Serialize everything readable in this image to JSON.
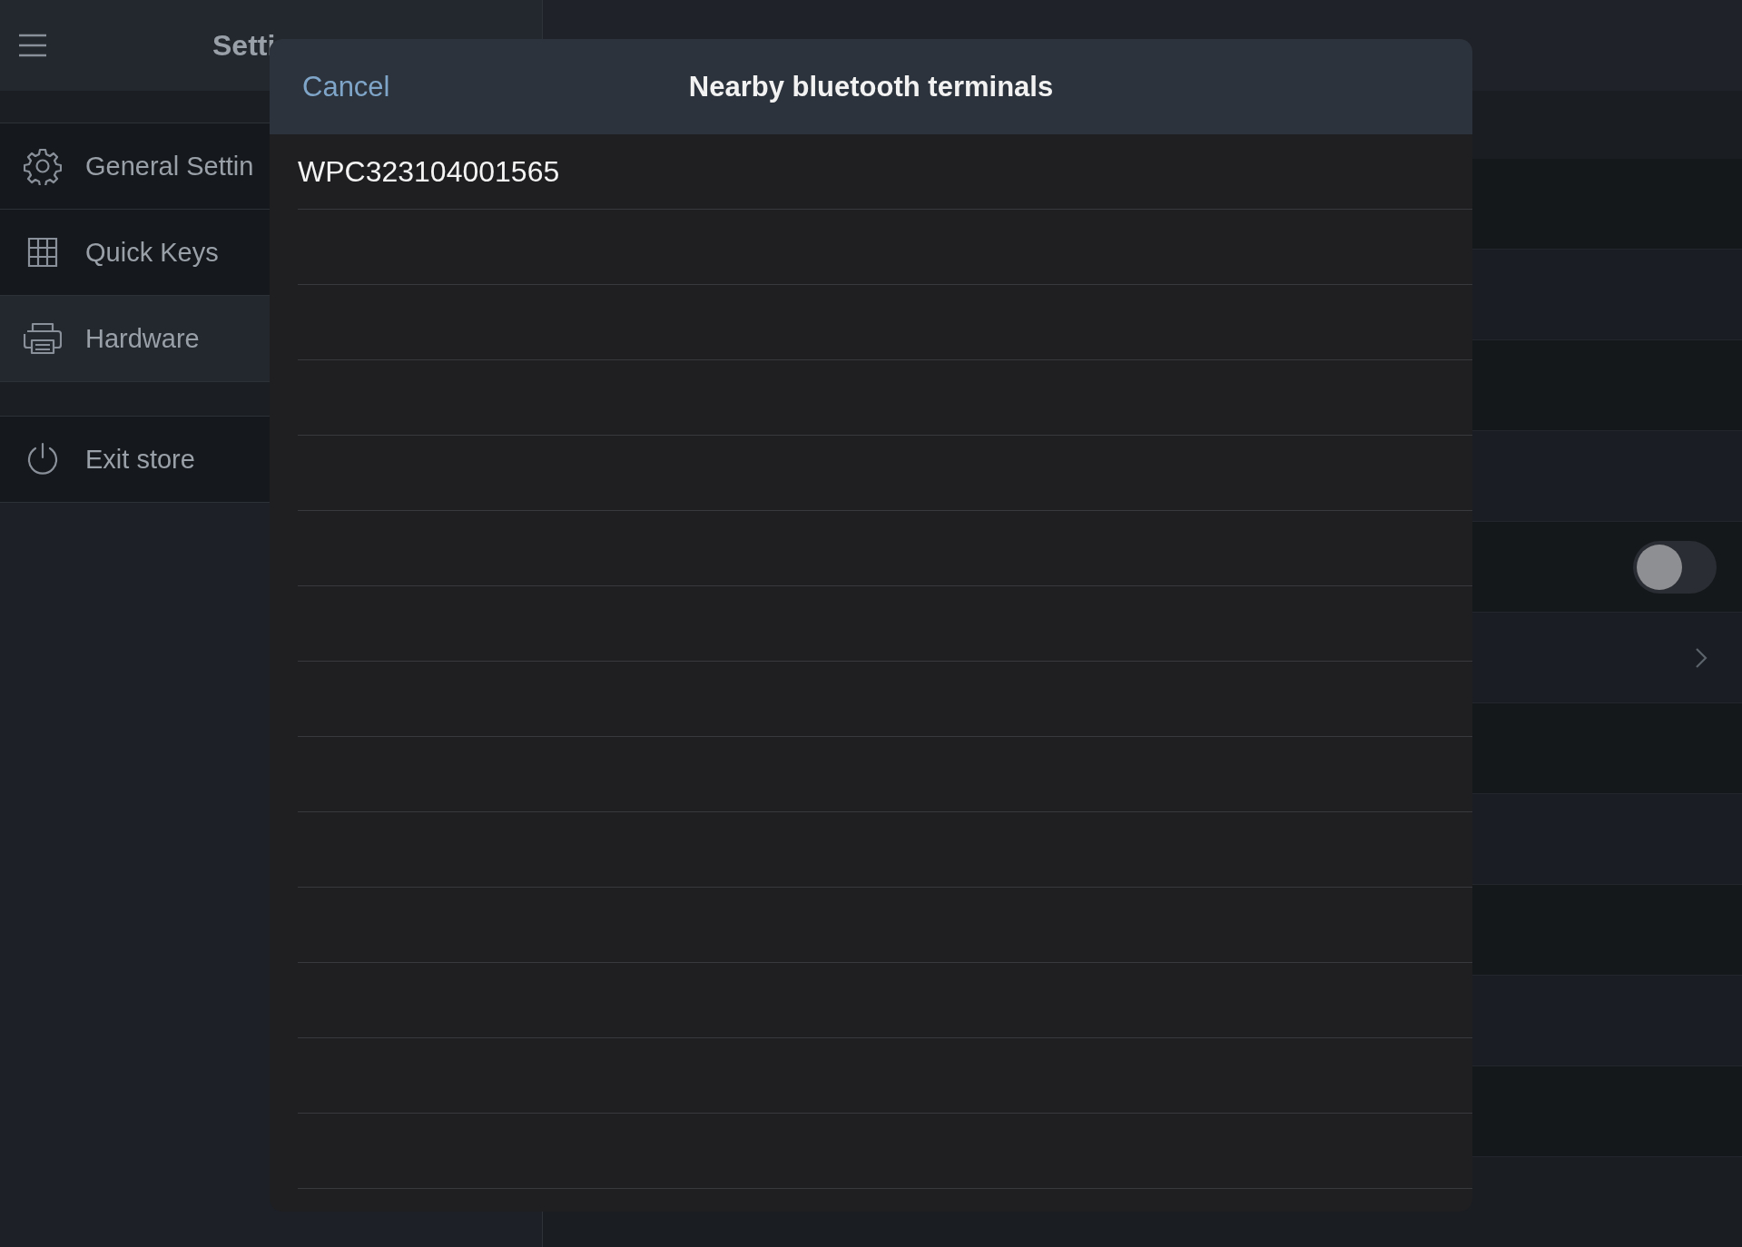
{
  "sidebar": {
    "title": "Setti",
    "items": [
      {
        "label": "General Settin",
        "selected": false
      },
      {
        "label": "Quick Keys",
        "selected": false
      },
      {
        "label": "Hardware",
        "selected": true
      }
    ],
    "footer_item": {
      "label": "Exit store"
    }
  },
  "background_rows": [
    {
      "kind": "blank"
    },
    {
      "kind": "blank"
    },
    {
      "kind": "blank"
    },
    {
      "kind": "blank"
    },
    {
      "kind": "toggle",
      "on": false
    },
    {
      "kind": "link"
    },
    {
      "kind": "blank"
    },
    {
      "kind": "blank"
    },
    {
      "kind": "blank"
    },
    {
      "kind": "blank"
    },
    {
      "kind": "blank"
    }
  ],
  "dialog": {
    "cancel": "Cancel",
    "title": "Nearby bluetooth terminals",
    "terminals": [
      {
        "name": "WPC323104001565"
      }
    ]
  }
}
